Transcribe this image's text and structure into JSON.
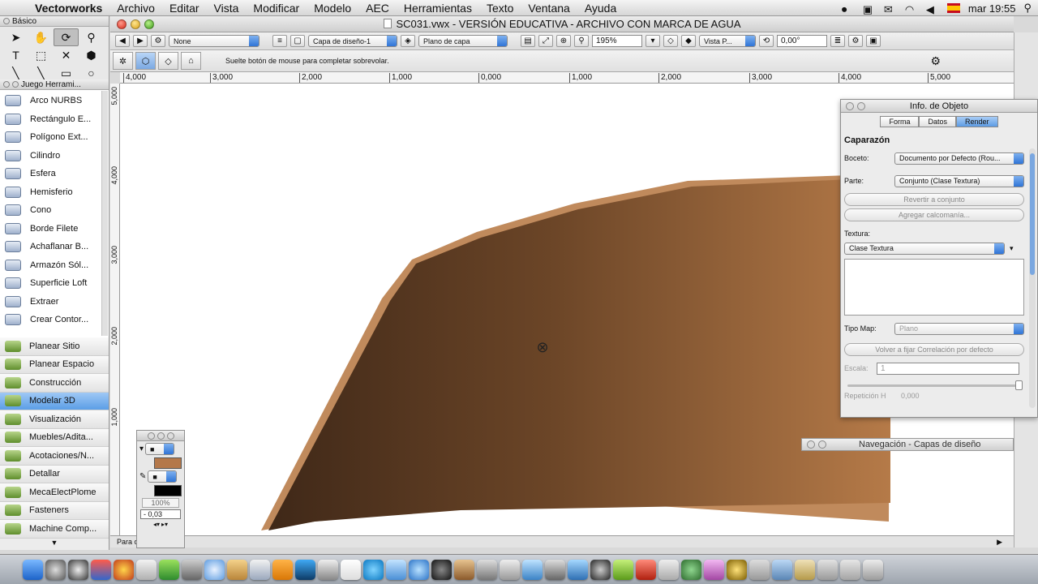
{
  "menubar": {
    "apple": "",
    "app": "Vectorworks",
    "items": [
      "Archivo",
      "Editar",
      "Vista",
      "Modificar",
      "Modelo",
      "AEC",
      "Herramientas",
      "Texto",
      "Ventana",
      "Ayuda"
    ],
    "clock": "mar 19:55"
  },
  "basic_palette": {
    "title": "Básico"
  },
  "toolset": {
    "title": "Juego Herrami...",
    "items": [
      "Arco NURBS",
      "Rectángulo E...",
      "Polígono Ext...",
      "Cilindro",
      "Esfera",
      "Hemisferio",
      "Cono",
      "Borde Filete",
      "Achaflanar B...",
      "Armazón Sól...",
      "Superficie Loft",
      "Extraer",
      "Crear Contor..."
    ]
  },
  "workgroups": {
    "items": [
      "Planear Sitio",
      "Planear Espacio",
      "Construcción",
      "Modelar 3D",
      "Visualización",
      "Muebles/Adita...",
      "Acotaciones/N...",
      "Detallar",
      "MecaElectPlome",
      "Fasteners",
      "Machine Comp..."
    ],
    "selected": "Modelar 3D"
  },
  "document": {
    "title": "SC031.vwx - VERSIÓN EDUCATIVA - ARCHIVO CON MARCA DE AGUA",
    "view_bar": {
      "class": "None",
      "layer": "Capa de diseño-1",
      "plane": "Plano de capa",
      "zoom": "195%",
      "view": "Vista P...",
      "angle": "0,00°"
    },
    "mode_bar_help": "Suelte botón de mouse para completar sobrevolar.",
    "ruler_top": [
      "4,000",
      "3,000",
      "2,000",
      "1,000",
      "0,000",
      "1,000",
      "2,000",
      "3,000",
      "4,000",
      "5,000"
    ],
    "ruler_left": [
      "5,000",
      "4,000",
      "3,000",
      "2,000",
      "1,000"
    ],
    "status": "Para                        onar F1",
    "shape_color": "#8b5a33"
  },
  "attributes": {
    "fill_color": "#b4784a",
    "pen_color": "#000000",
    "opacity": "100%",
    "thickness": "- 0,03"
  },
  "oip": {
    "title": "Info. de Objeto",
    "tabs": [
      "Forma",
      "Datos",
      "Render"
    ],
    "selected_tab": "Render",
    "section": "Caparazón",
    "boceto_label": "Boceto:",
    "boceto_value": "Documento por Defecto (Rou...",
    "parte_label": "Parte:",
    "parte_value": "Conjunto (Clase Textura)",
    "btn_revert": "Revertir a conjunto",
    "btn_decal": "Agregar calcomanía...",
    "textura_label": "Textura:",
    "textura_value": "Clase Textura",
    "tipomap_label": "Tipo Map:",
    "tipomap_value": "Plano",
    "btn_reset": "Volver a fijar Correlación por defecto",
    "escala_label": "Escala:",
    "escala_value": "1",
    "cut_label": "Repetición H",
    "cut_value": "0,000"
  },
  "nav_palette": {
    "title": "Navegación - Capas de diseño"
  }
}
